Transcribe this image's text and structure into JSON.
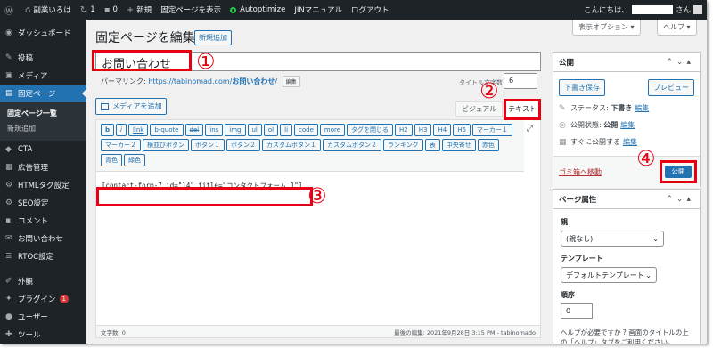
{
  "adminbar": {
    "wp_logo": "wordpress-logo",
    "site_name": "副業いろは",
    "updates_count": "1",
    "comments_count": "0",
    "new_label": "新規",
    "view_page": "固定ページを表示",
    "autoptimize": "Autoptimize",
    "jin_manual": "JINマニュアル",
    "logout": "ログアウト",
    "greeting": "こんにちは、",
    "greeting_suffix": "さん"
  },
  "sidebar": {
    "dashboard": "ダッシュボード",
    "posts": "投稿",
    "media": "メディア",
    "pages": "固定ページ",
    "pages_sub": [
      "固定ページ一覧",
      "新規追加"
    ],
    "cta": "CTA",
    "ads": "広告管理",
    "html_tags": "HTMLタグ設定",
    "seo": "SEO設定",
    "comments": "コメント",
    "contact": "お問い合わせ",
    "rtoc": "RTOC設定",
    "appearance": "外観",
    "plugins": "プラグイン",
    "plugins_badge": "1",
    "users": "ユーザー",
    "tools": "ツール"
  },
  "header": {
    "title": "固定ページを編集",
    "add_new": "新規追加",
    "screen_options": "表示オプション ▾",
    "help": "ヘルプ ▾"
  },
  "editor": {
    "title_value": "お問い合わせ",
    "permalink_label": "パーマリンク:",
    "permalink_base": "https://tabinomad.com/",
    "permalink_slug": "お問い合わせ",
    "permalink_end": "/",
    "permalink_edit": "編集",
    "title_count_label": "タイトル文字数",
    "title_count": "6",
    "add_media": "メディアを追加",
    "tab_visual": "ビジュアル",
    "tab_text": "テキスト",
    "content": "[contact-form-7 id=\"14\" title=\"コンタクトフォーム 1\"]",
    "word_count": "文字数: 0",
    "last_edited": "最後の編集: 2021年9月28日 3:15 PM - tabinomado"
  },
  "quicktags": [
    "b",
    "i",
    "link",
    "b-quote",
    "del",
    "ins",
    "img",
    "ul",
    "ol",
    "li",
    "code",
    "more",
    "タグを閉じる",
    "H2",
    "H3",
    "H4",
    "H5",
    "マーカー１",
    "マーカー２",
    "横並びボタン",
    "ボタン１",
    "ボタン２",
    "カスタムボタン１",
    "カスタムボタン２",
    "ランキング",
    "表",
    "中央寄せ",
    "赤色",
    "青色",
    "緑色"
  ],
  "annotations": {
    "one": "①",
    "two": "②",
    "three": "③",
    "four": "④"
  },
  "publish_box": {
    "title": "公開",
    "save_draft": "下書き保存",
    "preview": "プレビュー",
    "status_label": "ステータス:",
    "status_value": "下書き",
    "status_edit": "編集",
    "visibility_label": "公開状態:",
    "visibility_value": "公開",
    "visibility_edit": "編集",
    "schedule_label": "すぐに公開する",
    "schedule_edit": "編集",
    "trash": "ゴミ箱へ移動",
    "publish": "公開"
  },
  "attributes_box": {
    "title": "ページ属性",
    "parent_label": "親",
    "parent_value": "(親なし)",
    "template_label": "テンプレート",
    "template_value": "デフォルトテンプレート",
    "order_label": "順序",
    "order_value": "0",
    "help": "ヘルプが必要ですか ? 画面のタイトルの上の「ヘルプ」タブをご利用ください。"
  },
  "colors": {
    "admin_dark": "#1d2327",
    "accent_blue": "#2271b1",
    "highlight_red": "#e60012"
  }
}
